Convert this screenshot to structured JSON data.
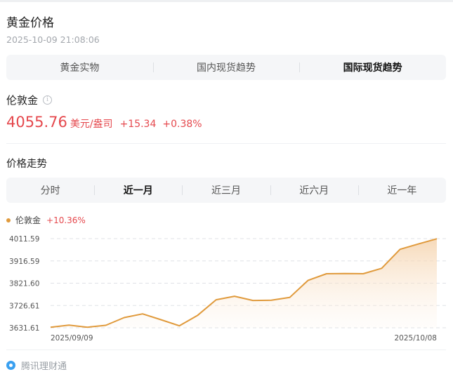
{
  "header": {
    "title": "黄金价格",
    "timestamp": "2025-10-09 21:08:06"
  },
  "main_tabs": [
    {
      "label": "黄金实物",
      "active": false
    },
    {
      "label": "国内现货趋势",
      "active": false
    },
    {
      "label": "国际现货趋势",
      "active": true
    }
  ],
  "quote": {
    "name": "伦敦金",
    "price": "4055.76",
    "unit": "美元/盎司",
    "change": "+15.34",
    "change_pct": "+0.38%"
  },
  "trend_section": {
    "title": "价格走势"
  },
  "range_tabs": [
    {
      "label": "分时",
      "active": false
    },
    {
      "label": "近一月",
      "active": true
    },
    {
      "label": "近三月",
      "active": false
    },
    {
      "label": "近六月",
      "active": false
    },
    {
      "label": "近一年",
      "active": false
    }
  ],
  "legend": {
    "name": "伦敦金",
    "pct": "+10.36%"
  },
  "colors": {
    "line": "#e09a3c",
    "up": "#e5484d",
    "fill_top": "#f5d3ad"
  },
  "chart_data": {
    "type": "area",
    "y_ticks": [
      "4011.59",
      "3916.59",
      "3821.60",
      "3726.61",
      "3631.61"
    ],
    "ylim": [
      3631.61,
      4011.59
    ],
    "x_start_label": "2025/09/09",
    "x_end_label": "2025/10/08",
    "series": [
      {
        "name": "伦敦金",
        "values": [
          3634,
          3643,
          3634,
          3642,
          3675,
          3691,
          3666,
          3640,
          3685,
          3751,
          3766,
          3748,
          3749,
          3761,
          3834,
          3862,
          3863,
          3862,
          3885,
          3966,
          3989,
          4011
        ]
      }
    ]
  },
  "footer": {
    "brand": "腾讯理财通"
  }
}
